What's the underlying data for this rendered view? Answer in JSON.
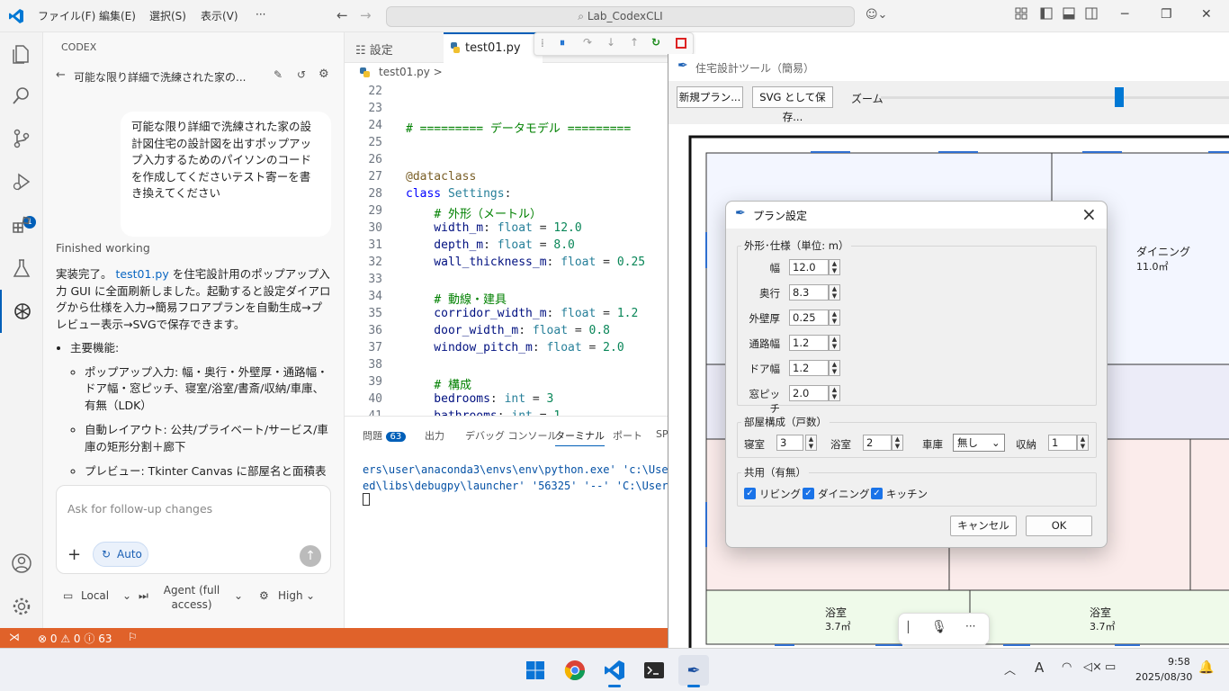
{
  "titlebar": {
    "menus": [
      "ファイル(F)",
      "編集(E)",
      "選択(S)",
      "表示(V)",
      "···"
    ],
    "search": "Lab_CodexCLI"
  },
  "activity": {
    "debug_badge": "1"
  },
  "codex": {
    "header": "CODEX",
    "chat_title": "可能な限り詳細で洗練された家の...",
    "user_message": "可能な限り詳細で洗練された家の設計図住宅の設計図を出すポップアップ入力するためのパイソンのコードを作成してくださいテスト寄ーを書き換えてください",
    "status": "Finished working",
    "answer_intro_1": "実装完了。",
    "answer_file": "test01.py",
    "answer_intro_2": " を住宅設計用のポップアップ入力 GUI に全面刷新しました。起動すると設定ダイアログから仕様を入力→簡易フロアプランを自動生成→プレビュー表示→SVGで保存できます。",
    "features_title": "主要機能:",
    "features": [
      "ポップアップ入力: 幅・奥行・外壁厚・通路幅・ドア幅・窓ピッチ、寝室/浴室/書斎/収納/車庫、有無（LDK）",
      "自動レイアウト: 公共/プライベート/サービス/車庫の矩形分割＋廊下",
      "プレビュー: Tkinter Canvas に部屋名と面積表"
    ],
    "compose_placeholder": "Ask for follow-up changes",
    "auto_label": "Auto",
    "footer": {
      "local": "Local",
      "agent": "Agent (full access)",
      "level": "High"
    }
  },
  "statusbar": {
    "errors": "0",
    "warnings": "0",
    "info": "63"
  },
  "editor": {
    "tab_settings": "設定",
    "tab_file": "test01.py",
    "breadcrumb": "test01.py >",
    "line_numbers": [
      "22",
      "23",
      "24",
      "25",
      "26",
      "27",
      "28",
      "29",
      "30",
      "31",
      "32",
      "33",
      "34",
      "35",
      "36",
      "37",
      "38",
      "39",
      "40",
      "41"
    ]
  },
  "panel": {
    "tabs": [
      "問題",
      "出力",
      "デバッグ コンソール",
      "ターミナル",
      "ポート",
      "SP"
    ],
    "problems_count": "63",
    "terminal_lines": [
      "ers\\user\\anaconda3\\envs\\env\\python.exe' 'c:\\Users",
      "ed\\libs\\debugpy\\launcher' '56325' '--' 'C:\\Users"
    ]
  },
  "app": {
    "title": "住宅設計ツール（簡易）",
    "new_plan": "新規プラン...",
    "save_svg": "SVG として保存...",
    "zoom": "ズーム",
    "zoom_level": 0.6,
    "rooms": [
      {
        "name": "ダイニング",
        "area": "11.0㎡"
      },
      {
        "name": "浴室",
        "area": "3.7㎡"
      },
      {
        "name": "浴室",
        "area": "3.7㎡"
      }
    ]
  },
  "dialog": {
    "title": "プラン設定",
    "group_outline": "外形･仕様（単位: m）",
    "fields": [
      {
        "label": "幅",
        "value": "12.0"
      },
      {
        "label": "奥行",
        "value": "8.3"
      },
      {
        "label": "外壁厚",
        "value": "0.25"
      },
      {
        "label": "通路幅",
        "value": "1.2"
      },
      {
        "label": "ドア幅",
        "value": "1.2"
      },
      {
        "label": "窓ピッチ",
        "value": "2.0"
      }
    ],
    "group_rooms": "部屋構成（戸数）",
    "bedroom_label": "寝室",
    "bedroom_value": "3",
    "bath_label": "浴室",
    "bath_value": "2",
    "garage_label": "車庫",
    "garage_value": "無し",
    "storage_label": "収納",
    "storage_value": "1",
    "group_shared": "共用（有無）",
    "shared": [
      "リビング",
      "ダイニング",
      "キッチン"
    ],
    "cancel": "キャンセル",
    "ok": "OK"
  },
  "taskbar": {
    "time": "9:58",
    "date": "2025/08/30"
  }
}
